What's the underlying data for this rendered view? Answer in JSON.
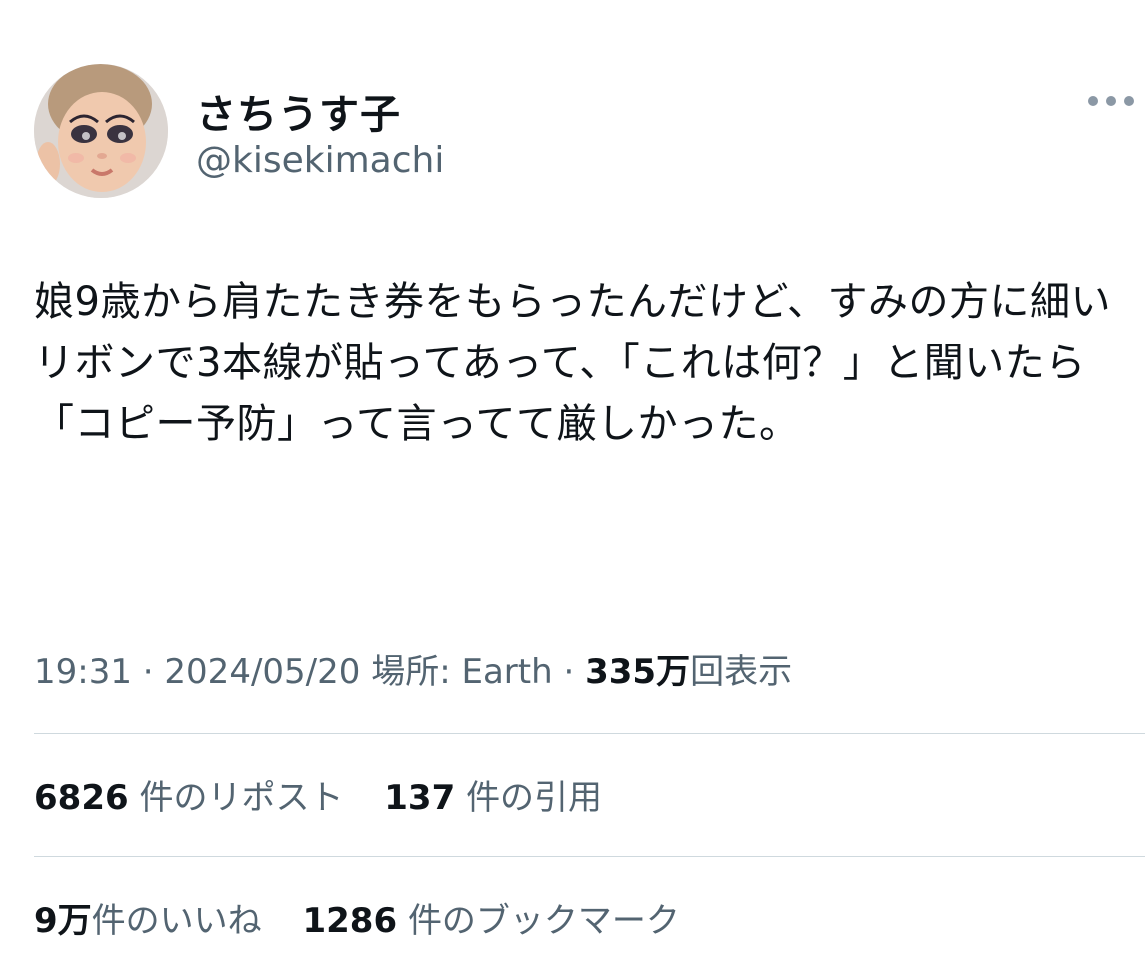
{
  "author": {
    "display_name": "さちうす子",
    "handle": "@kisekimachi"
  },
  "more_icon": "more-horizontal-icon",
  "tweet": {
    "text": "娘9歳から肩たたき券をもらったんだけど、すみの方に細いリボンで3本線が貼ってあって、「これは何？」と聞いたら「コピー予防」って言ってて厳しかった。"
  },
  "meta": {
    "time": "19:31",
    "sep1": " · ",
    "date": "2024/05/20",
    "location_label": "場所: Earth",
    "sep2": " · ",
    "views_count": "335万",
    "views_label": "回表示"
  },
  "stats": {
    "reposts_count": "6826",
    "reposts_label": "件のリポスト",
    "quotes_count": "137",
    "quotes_label": "件の引用",
    "likes_count": "9万",
    "likes_label": "件のいいね",
    "bookmarks_count": "1286",
    "bookmarks_label": "件のブックマーク"
  },
  "colors": {
    "text": "#0f1419",
    "secondary": "#536471",
    "divider": "#cfd9de"
  }
}
